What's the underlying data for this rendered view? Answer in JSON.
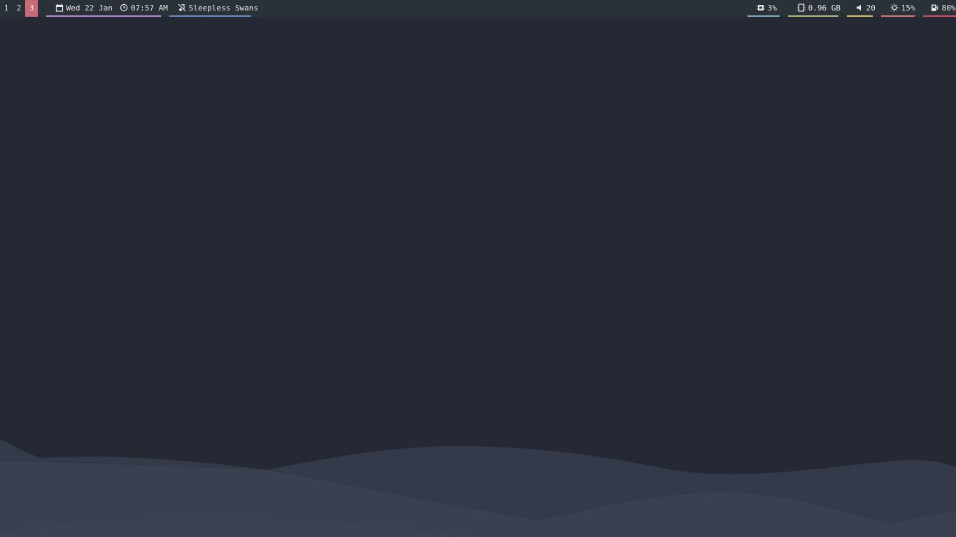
{
  "workspaces": [
    {
      "label": "1",
      "active": false
    },
    {
      "label": "2",
      "active": false
    },
    {
      "label": "3",
      "active": true
    }
  ],
  "datetime": {
    "date": "Wed 22 Jan",
    "time": "07:57 AM",
    "date_icon": "calendar-icon",
    "time_icon": "clock-icon"
  },
  "media": {
    "title": "Sleepless Swans",
    "icon": "music-off-icon"
  },
  "status": {
    "cpu": {
      "value": "3%",
      "icon": "cpu-icon"
    },
    "memory": {
      "value": "0.96 GB",
      "icon": "memory-icon"
    },
    "volume": {
      "value": "20",
      "icon": "speaker-icon"
    },
    "brightness": {
      "value": "15%",
      "icon": "sun-icon"
    },
    "battery": {
      "value": "80%",
      "icon": "battery-charging-icon"
    }
  },
  "colors": {
    "bar_bg": "#2b3139",
    "desktop_bg": "#252934",
    "active_workspace": "#c96a76",
    "datetime_underline": "#b58ad1",
    "media_underline": "#6a8fc4",
    "cpu_underline": "#7fb3c3",
    "memory_underline": "#a7c27d",
    "volume_underline": "#e0c070",
    "brightness_underline": "#d17a7a",
    "battery_underline": "#d0505f"
  }
}
